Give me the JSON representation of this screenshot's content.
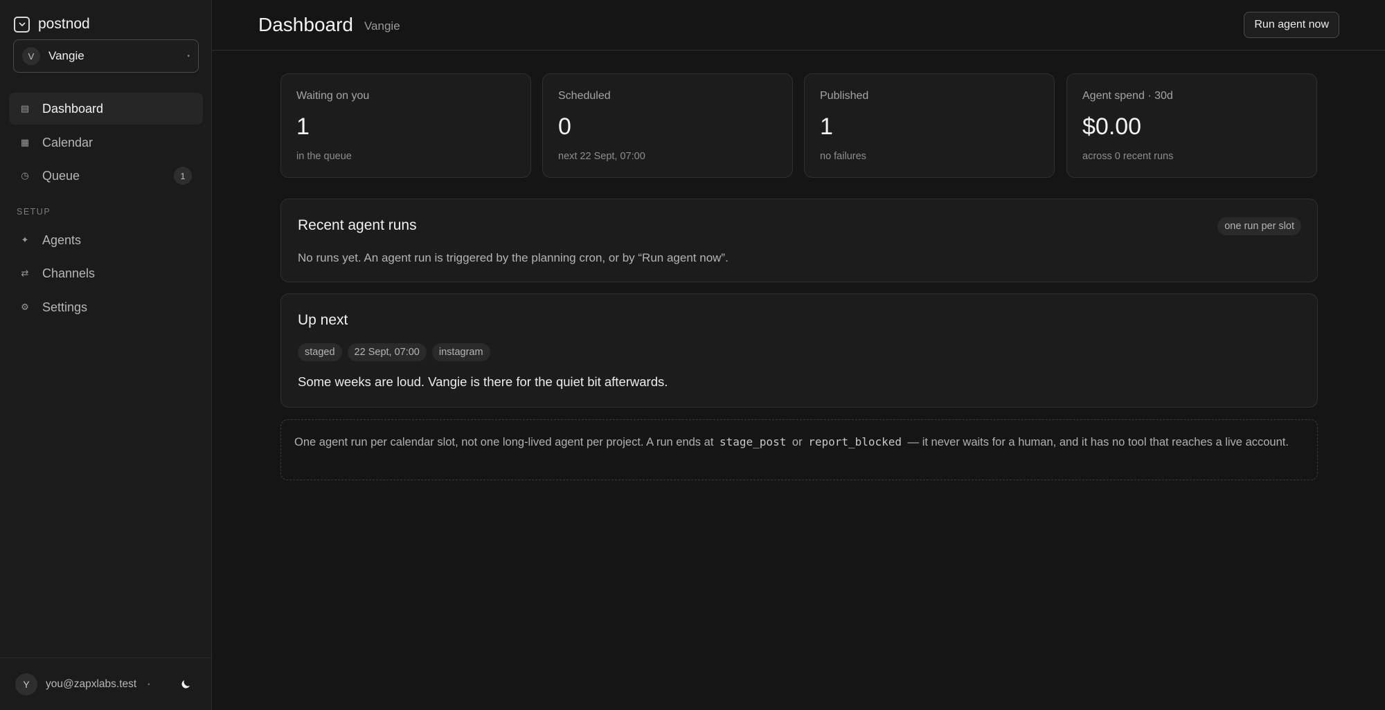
{
  "sidebar": {
    "brand": "postnod",
    "project": {
      "avatar": "V",
      "name": "Vangie"
    },
    "nav": [
      {
        "label": "Dashboard",
        "icon": "dashboard-icon",
        "active": true
      },
      {
        "label": "Calendar",
        "icon": "calendar-icon"
      },
      {
        "label": "Queue",
        "icon": "clock-icon",
        "badge": "1"
      }
    ],
    "setup_label": "SETUP",
    "setup_nav": [
      {
        "label": "Agents",
        "icon": "sparkle-icon"
      },
      {
        "label": "Channels",
        "icon": "arrows-icon"
      },
      {
        "label": "Settings",
        "icon": "gear-icon"
      }
    ],
    "user": {
      "avatar": "Y",
      "email": "you@zapxlabs.test"
    }
  },
  "header": {
    "title": "Dashboard",
    "subtitle": "Vangie",
    "run_button": "Run agent now"
  },
  "stats": [
    {
      "label": "Waiting on you",
      "value": "1",
      "sub": "in the queue"
    },
    {
      "label": "Scheduled",
      "value": "0",
      "sub": "next 22 Sept, 07:00"
    },
    {
      "label": "Published",
      "value": "1",
      "sub": "no failures"
    },
    {
      "label": "Agent spend · 30d",
      "value": "$0.00",
      "sub": "across 0 recent runs"
    }
  ],
  "recent_runs": {
    "title": "Recent agent runs",
    "badge": "one run per slot",
    "empty_text": "No runs yet. An agent run is triggered by the planning cron, or by “Run agent now”."
  },
  "up_next": {
    "title": "Up next",
    "chips": [
      "staged",
      "22 Sept, 07:00",
      "instagram"
    ],
    "body": "Some weeks are loud. Vangie is there for the quiet bit afterwards."
  },
  "note": {
    "part1": "One agent run per calendar slot, not one long-lived agent per project. A run ends at",
    "code1": "stage_post",
    "part2": "or",
    "code2": "report_blocked",
    "part3": "— it never waits for a human, and it has no tool that reaches a live account."
  },
  "colors": {
    "background": "#151515",
    "sidebar": "#1b1b1b",
    "card": "#1c1c1c",
    "border": "#303030"
  }
}
